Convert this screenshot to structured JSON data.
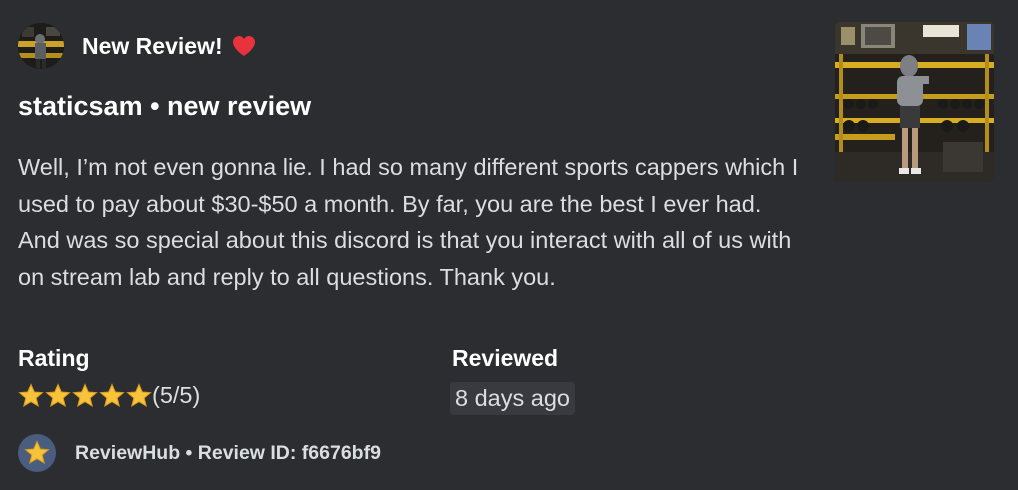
{
  "author": {
    "name": "New Review!",
    "avatar_icon": "gym-photo-avatar"
  },
  "title": "staticsam • new review",
  "description": "Well, I’m not even gonna lie. I had so many different sports cappers which I used to pay about $30-$50 a month. By far, you are the best I ever had. And was so special about this discord is that you interact with all of us with on stream lab and reply to all questions. Thank you.",
  "fields": {
    "rating": {
      "name": "Rating",
      "stars": 5,
      "value_text": "(5/5)"
    },
    "reviewed": {
      "name": "Reviewed",
      "value": "8 days ago"
    }
  },
  "thumbnail_icon": "gym-photo-thumbnail",
  "footer": {
    "icon": "star-icon",
    "text": "ReviewHub • Review ID: f6676bf9"
  },
  "colors": {
    "background": "#2b2d31",
    "heart": "#e8323c",
    "star": "#f6c33b",
    "pill": "#383a40"
  }
}
